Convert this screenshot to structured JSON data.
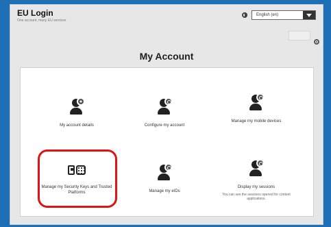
{
  "header": {
    "brand_title": "EU Login",
    "brand_subtitle": "One account, many EU services",
    "language_selected": "English (en)"
  },
  "page": {
    "title": "My Account"
  },
  "tiles": [
    {
      "label": "My account details",
      "icon": "user-info-icon"
    },
    {
      "label": "Configure my account",
      "icon": "user-settings-icon"
    },
    {
      "label": "Manage my mobile devices",
      "icon": "user-mobile-icon"
    },
    {
      "label": "Manage my Security Keys and Trusted Platforms",
      "icon": "security-key-icon"
    },
    {
      "label": "Manage my eIDs",
      "icon": "user-eid-icon"
    },
    {
      "label": "Display my sessions",
      "icon": "user-sessions-icon",
      "description": "You can see the sessions opened for content applications."
    }
  ],
  "colors": {
    "background": "#1f6fb6",
    "highlight": "#e11212"
  }
}
